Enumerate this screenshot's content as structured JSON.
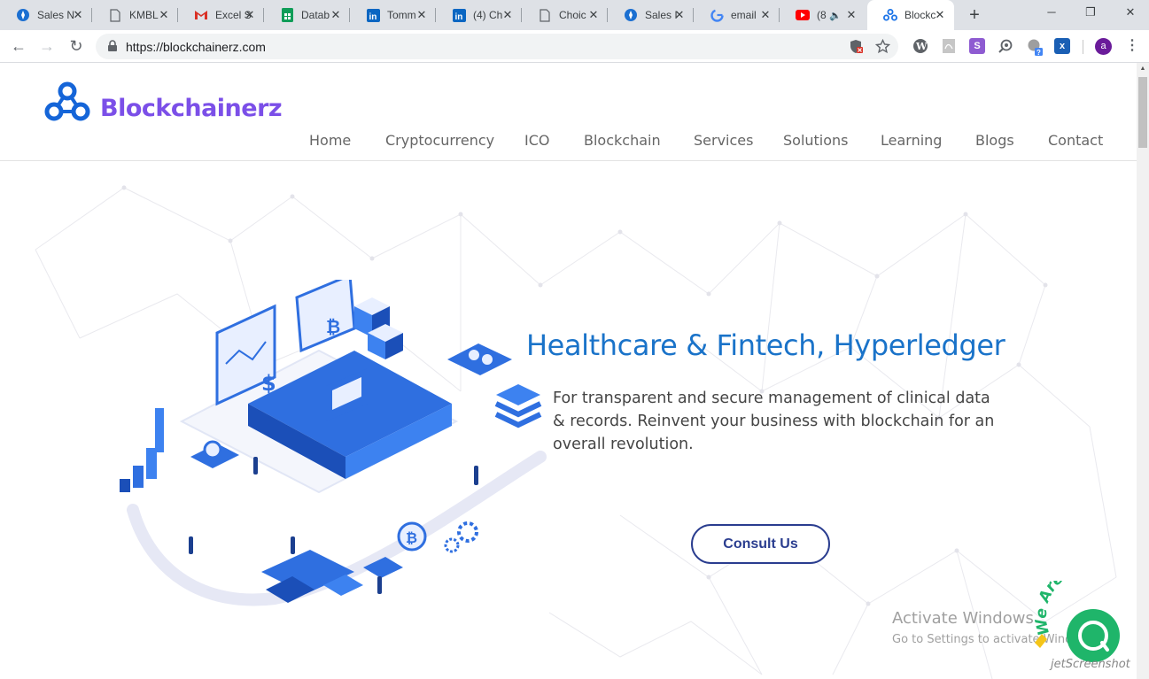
{
  "browser": {
    "tabs": [
      {
        "title": "Sales N",
        "icon": "compass-icon"
      },
      {
        "title": "KMBL",
        "icon": "document-icon"
      },
      {
        "title": "Excel S",
        "icon": "gmail-icon"
      },
      {
        "title": "Datab",
        "icon": "sheets-icon"
      },
      {
        "title": "Tomm",
        "icon": "linkedin-icon"
      },
      {
        "title": "(4) Ch",
        "icon": "linkedin-icon"
      },
      {
        "title": "Choic",
        "icon": "document-icon"
      },
      {
        "title": "Sales I",
        "icon": "compass-icon"
      },
      {
        "title": "email",
        "icon": "google-icon"
      },
      {
        "title": "(8",
        "icon": "youtube-icon"
      },
      {
        "title": "Blockc",
        "icon": "blockchainerz-icon",
        "active": true
      }
    ],
    "url": "https://blockchainerz.com",
    "profile_initial": "a",
    "extension_badge": "?"
  },
  "site": {
    "logo_text": "Blockchainerz",
    "nav": [
      "Home",
      "Cryptocurrency",
      "ICO",
      "Blockchain",
      "Services",
      "Solutions",
      "Learning",
      "Blogs",
      "Contact"
    ]
  },
  "hero": {
    "title": "Healthcare & Fintech, Hyperledger",
    "description": "For transparent and secure management of clinical data & records. Reinvent your business with blockchain for an overall revolution.",
    "cta_label": "Consult Us"
  },
  "overlay": {
    "activate_title": "Activate Windows",
    "activate_subtitle": "Go to Settings to activate Windows.",
    "chat_text": "We Are Here!",
    "watermark": "jetScreenshot"
  },
  "colors": {
    "brand_purple": "#7b4fe8",
    "brand_blue": "#1a73c9",
    "cta_border": "#2a3d8f",
    "chat_green": "#1fb56a"
  }
}
